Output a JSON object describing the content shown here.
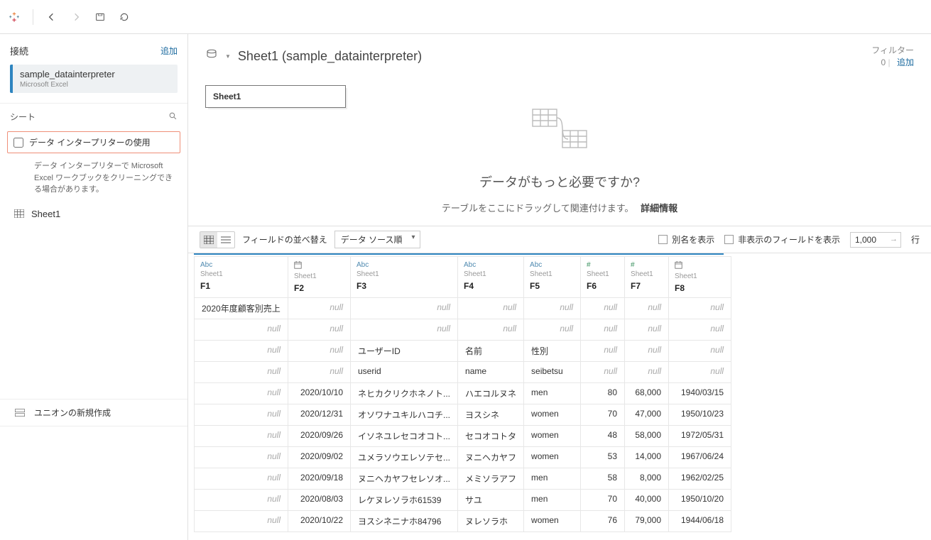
{
  "toolbar": {},
  "sidebar": {
    "connections_label": "接続",
    "add_label": "追加",
    "connection": {
      "name": "sample_datainterpreter",
      "subtype": "Microsoft Excel"
    },
    "sheets_label": "シート",
    "interpreter_checkbox_label": "データ インタープリターの使用",
    "interpreter_desc": "データ インタープリターで Microsoft Excel ワークブックをクリーニングできる場合があります。",
    "sheet_items": [
      {
        "label": "Sheet1"
      }
    ],
    "union_label": "ユニオンの新規作成"
  },
  "main": {
    "data_source_title": "Sheet1 (sample_datainterpreter)",
    "filter_label": "フィルター",
    "filter_count": "0",
    "filter_add": "追加",
    "sheet_chip": "Sheet1",
    "need_more": "データがもっと必要ですか?",
    "drop_hint_text": "テーブルをここにドラッグして関連付けます。",
    "drop_hint_details": "詳細情報"
  },
  "gridbar": {
    "sort_label": "フィールドの並べ替え",
    "sort_value": "データ ソース順",
    "show_alias": "別名を表示",
    "show_hidden": "非表示のフィールドを表示",
    "rows_value": "1,000",
    "rows_unit": "行"
  },
  "grid": {
    "table_name": "Sheet1",
    "columns": [
      {
        "key": "F1",
        "name": "F1",
        "type": "Abc",
        "width": "cF1",
        "align": "txt-l"
      },
      {
        "key": "F2",
        "name": "F2",
        "type": "date",
        "width": "cF2",
        "align": "date-r"
      },
      {
        "key": "F3",
        "name": "F3",
        "type": "Abc",
        "width": "cF3",
        "align": "txt-l"
      },
      {
        "key": "F4",
        "name": "F4",
        "type": "Abc",
        "width": "cF4",
        "align": "txt-l"
      },
      {
        "key": "F5",
        "name": "F5",
        "type": "Abc",
        "width": "cF5",
        "align": "txt-l"
      },
      {
        "key": "F6",
        "name": "F6",
        "type": "num",
        "width": "cF6",
        "align": "num-r"
      },
      {
        "key": "F7",
        "name": "F7",
        "type": "num",
        "width": "cF7",
        "align": "num-r"
      },
      {
        "key": "F8",
        "name": "F8",
        "type": "date",
        "width": "cF8",
        "align": "date-r"
      }
    ],
    "rows": [
      {
        "F1": "2020年度顧客別売上",
        "F2": null,
        "F3": null,
        "F4": null,
        "F5": null,
        "F6": null,
        "F7": null,
        "F8": null
      },
      {
        "F1": null,
        "F2": null,
        "F3": null,
        "F4": null,
        "F5": null,
        "F6": null,
        "F7": null,
        "F8": null
      },
      {
        "F1": null,
        "F2": null,
        "F3": "ユーザーID",
        "F4": "名前",
        "F5": "性別",
        "F6": null,
        "F7": null,
        "F8": null
      },
      {
        "F1": null,
        "F2": null,
        "F3": "userid",
        "F4": "name",
        "F5": "seibetsu",
        "F6": null,
        "F7": null,
        "F8": null
      },
      {
        "F1": null,
        "F2": "2020/10/10",
        "F3": "ネヒカクリクホネノト...",
        "F4": "ハエコルヌネ",
        "F5": "men",
        "F6": "80",
        "F7": "68,000",
        "F8": "1940/03/15"
      },
      {
        "F1": null,
        "F2": "2020/12/31",
        "F3": "オソワナユキルハコチ...",
        "F4": "ヨスシネ",
        "F5": "women",
        "F6": "70",
        "F7": "47,000",
        "F8": "1950/10/23"
      },
      {
        "F1": null,
        "F2": "2020/09/26",
        "F3": "イソネユレセコオコト...",
        "F4": "セコオコトタ",
        "F5": "women",
        "F6": "48",
        "F7": "58,000",
        "F8": "1972/05/31"
      },
      {
        "F1": null,
        "F2": "2020/09/02",
        "F3": "ユメラソウエレソテセ...",
        "F4": "ヌニヘカヤフ",
        "F5": "women",
        "F6": "53",
        "F7": "14,000",
        "F8": "1967/06/24"
      },
      {
        "F1": null,
        "F2": "2020/09/18",
        "F3": "ヌニヘカヤフセレソオ...",
        "F4": "メミソラアフ",
        "F5": "men",
        "F6": "58",
        "F7": "8,000",
        "F8": "1962/02/25"
      },
      {
        "F1": null,
        "F2": "2020/08/03",
        "F3": "レケヌレソラホ61539",
        "F4": "サユ",
        "F5": "men",
        "F6": "70",
        "F7": "40,000",
        "F8": "1950/10/20"
      },
      {
        "F1": null,
        "F2": "2020/10/22",
        "F3": "ヨスシネニナホ84796",
        "F4": "ヌレソラホ",
        "F5": "women",
        "F6": "76",
        "F7": "79,000",
        "F8": "1944/06/18"
      }
    ]
  }
}
